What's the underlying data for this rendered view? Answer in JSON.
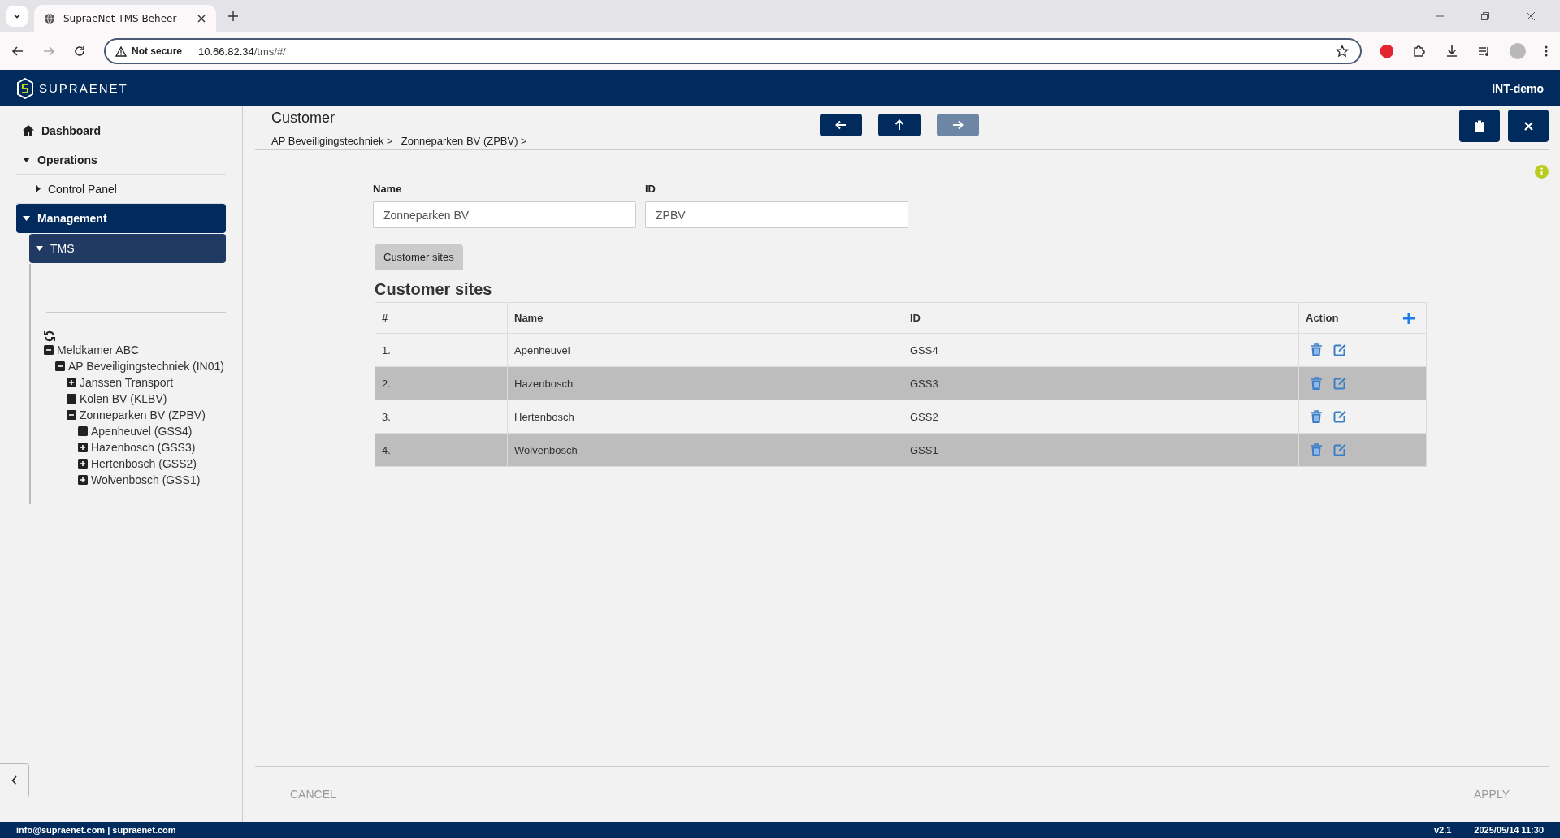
{
  "browser": {
    "tab_title": "SupraeNet TMS Beheer",
    "security": "Not secure",
    "url_host": "10.66.82.34",
    "url_path": "/tms/#/"
  },
  "app_header": {
    "brand": "SUPRAENET",
    "environment": "INT-demo"
  },
  "sidebar": {
    "items": [
      {
        "label": "Dashboard",
        "kind": "home",
        "selected": false
      },
      {
        "label": "Operations",
        "kind": "group",
        "expanded": true,
        "selected": false
      },
      {
        "label": "Control Panel",
        "kind": "sub",
        "expanded": false,
        "selected": false
      },
      {
        "label": "Management",
        "kind": "group",
        "expanded": true,
        "selected": true
      },
      {
        "label": "TMS",
        "kind": "sub",
        "expanded": true,
        "selected": true
      }
    ],
    "tree": [
      {
        "label": "Meldkamer ABC",
        "kind": "branch",
        "expanded": true,
        "children": [
          {
            "label": "AP Beveiligingstechniek (IN01)",
            "kind": "branch",
            "expanded": true,
            "children": [
              {
                "label": "Janssen Transport",
                "kind": "branch",
                "expanded": false
              },
              {
                "label": "Kolen BV (KLBV)",
                "kind": "leaf"
              },
              {
                "label": "Zonneparken BV (ZPBV)",
                "kind": "branch",
                "expanded": true,
                "children": [
                  {
                    "label": "Apenheuvel (GSS4)",
                    "kind": "leaf"
                  },
                  {
                    "label": "Hazenbosch (GSS3)",
                    "kind": "branch",
                    "expanded": false
                  },
                  {
                    "label": "Hertenbosch (GSS2)",
                    "kind": "branch",
                    "expanded": false
                  },
                  {
                    "label": "Wolvenbosch (GSS1)",
                    "kind": "branch",
                    "expanded": false
                  }
                ]
              }
            ]
          }
        ]
      }
    ]
  },
  "page": {
    "title": "Customer",
    "breadcrumb": [
      "AP Beveiligingstechniek >",
      "Zonneparken BV (ZPBV) >"
    ],
    "nav_buttons": [
      {
        "kind": "back",
        "disabled": false
      },
      {
        "kind": "up",
        "disabled": false
      },
      {
        "kind": "forward",
        "disabled": true
      }
    ],
    "fields": [
      {
        "label": "Name",
        "value": "Zonneparken BV"
      },
      {
        "label": "ID",
        "value": "ZPBV"
      }
    ],
    "tabs": [
      {
        "label": "Customer sites",
        "selected": true
      }
    ],
    "section_title": "Customer sites",
    "table": {
      "columns": [
        "#",
        "Name",
        "ID",
        "Action"
      ],
      "rows": [
        [
          "1.",
          "Apenheuvel",
          "GSS4"
        ],
        [
          "2.",
          "Hazenbosch",
          "GSS3"
        ],
        [
          "3.",
          "Hertenbosch",
          "GSS2"
        ],
        [
          "4.",
          "Wolvenbosch",
          "GSS1"
        ]
      ]
    },
    "footer_buttons": [
      "CANCEL",
      "APPLY"
    ]
  },
  "status_bar": {
    "contact": "info@supraenet.com | supraenet.com",
    "version": "v2.1",
    "datetime": "2025/05/14 11:30"
  }
}
